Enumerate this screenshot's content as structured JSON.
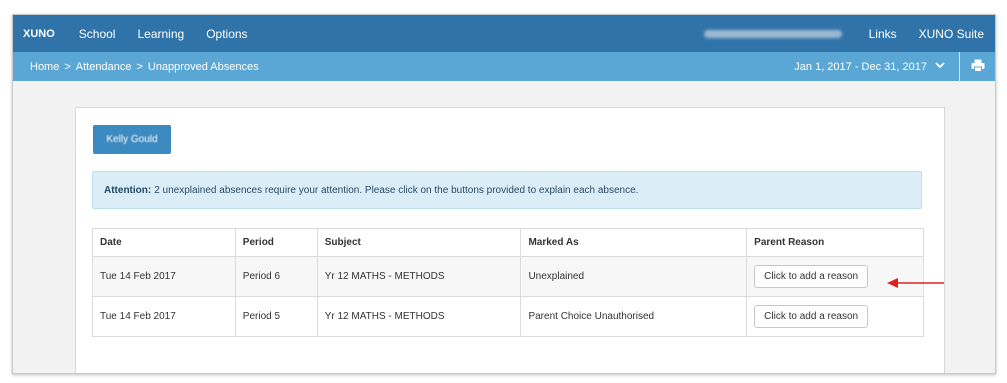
{
  "nav": {
    "brand": "XUNO",
    "items": [
      "School",
      "Learning",
      "Options"
    ],
    "right_items": [
      "Links",
      "XUNO Suite"
    ]
  },
  "breadcrumb": {
    "home": "Home",
    "sep": ">",
    "attendance": "Attendance",
    "current": "Unapproved Absences"
  },
  "date_range": "Jan 1, 2017 - Dec 31, 2017",
  "student_button": "Kelly Gould",
  "alert": {
    "strong": "Attention:",
    "text": "2 unexplained absences require your attention. Please click on the buttons provided to explain each absence."
  },
  "table": {
    "headers": [
      "Date",
      "Period",
      "Subject",
      "Marked As",
      "Parent Reason"
    ],
    "rows": [
      {
        "date": "Tue 14 Feb 2017",
        "period": "Period 6",
        "subject": "Yr 12 MATHS - METHODS",
        "marked_as": "Unexplained",
        "action": "Click to add a reason"
      },
      {
        "date": "Tue 14 Feb 2017",
        "period": "Period 5",
        "subject": "Yr 12 MATHS - METHODS",
        "marked_as": "Parent Choice Unauthorised",
        "action": "Click to add a reason"
      }
    ]
  },
  "colors": {
    "topnav": "#2f73a8",
    "subnav": "#5aa7d6",
    "alert_bg": "#dbeef8",
    "annotation_arrow": "#e02020"
  },
  "icons": {
    "date_dropdown": "chevron-down-icon",
    "print": "printer-icon",
    "annotation": "red-arrow-icon"
  }
}
